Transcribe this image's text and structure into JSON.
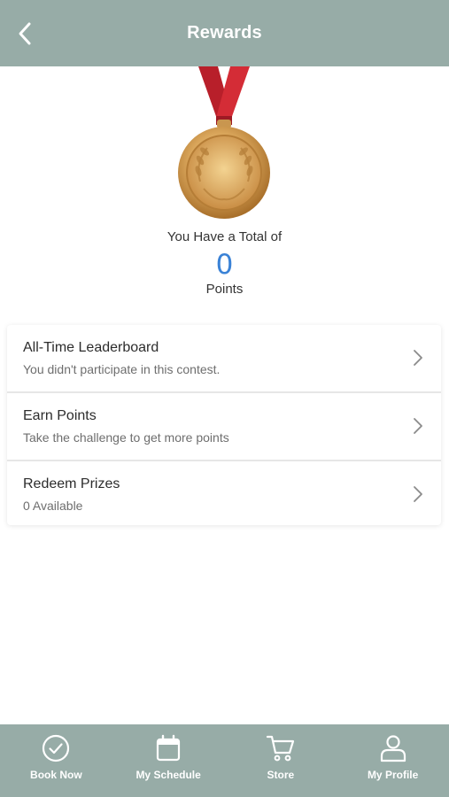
{
  "header": {
    "title": "Rewards",
    "back_icon": "chevron-left-icon"
  },
  "medal": {
    "icon": "gold-medal-icon",
    "ribbon_color": "#c9242f",
    "gold_color": "#d9a55a"
  },
  "summary": {
    "total_label": "You Have a Total of",
    "points_value": "0",
    "points_label": "Points"
  },
  "rewards_list": [
    {
      "title": "All-Time Leaderboard",
      "subtitle": "You didn't participate in this contest."
    },
    {
      "title": "Earn Points",
      "subtitle": "Take the challenge to get more points"
    },
    {
      "title": "Redeem Prizes",
      "subtitle": "0 Available"
    }
  ],
  "tabbar": {
    "items": [
      {
        "label": "Book Now",
        "icon": "check-circle-icon"
      },
      {
        "label": "My Schedule",
        "icon": "calendar-icon"
      },
      {
        "label": "Store",
        "icon": "cart-icon"
      },
      {
        "label": "My Profile",
        "icon": "person-icon"
      }
    ]
  },
  "colors": {
    "bar": "#97aca7",
    "accent": "#3a82d6"
  }
}
